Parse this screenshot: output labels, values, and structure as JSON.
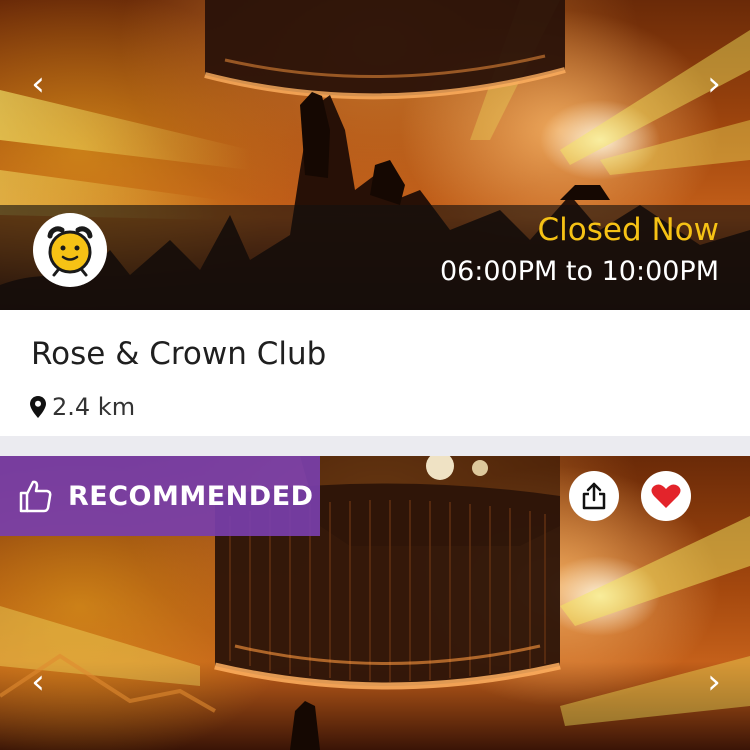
{
  "card1": {
    "status": "Closed Now",
    "hours": "06:00PM to 10:00PM",
    "status_color": "#f6c215",
    "status_icon": "alarm-clock-icon"
  },
  "venue": {
    "name": "Rose & Crown Club",
    "distance": "2.4 km"
  },
  "card2": {
    "badge_label": "RECOMMENDED",
    "badge_color": "#7a3eaa",
    "favorite_color": "#e3242b"
  },
  "icons": {
    "prev": "chevron-left-icon",
    "next": "chevron-right-icon",
    "share": "share-icon",
    "favorite": "heart-icon",
    "location": "location-pin-icon",
    "recommended": "thumbs-up-icon"
  }
}
